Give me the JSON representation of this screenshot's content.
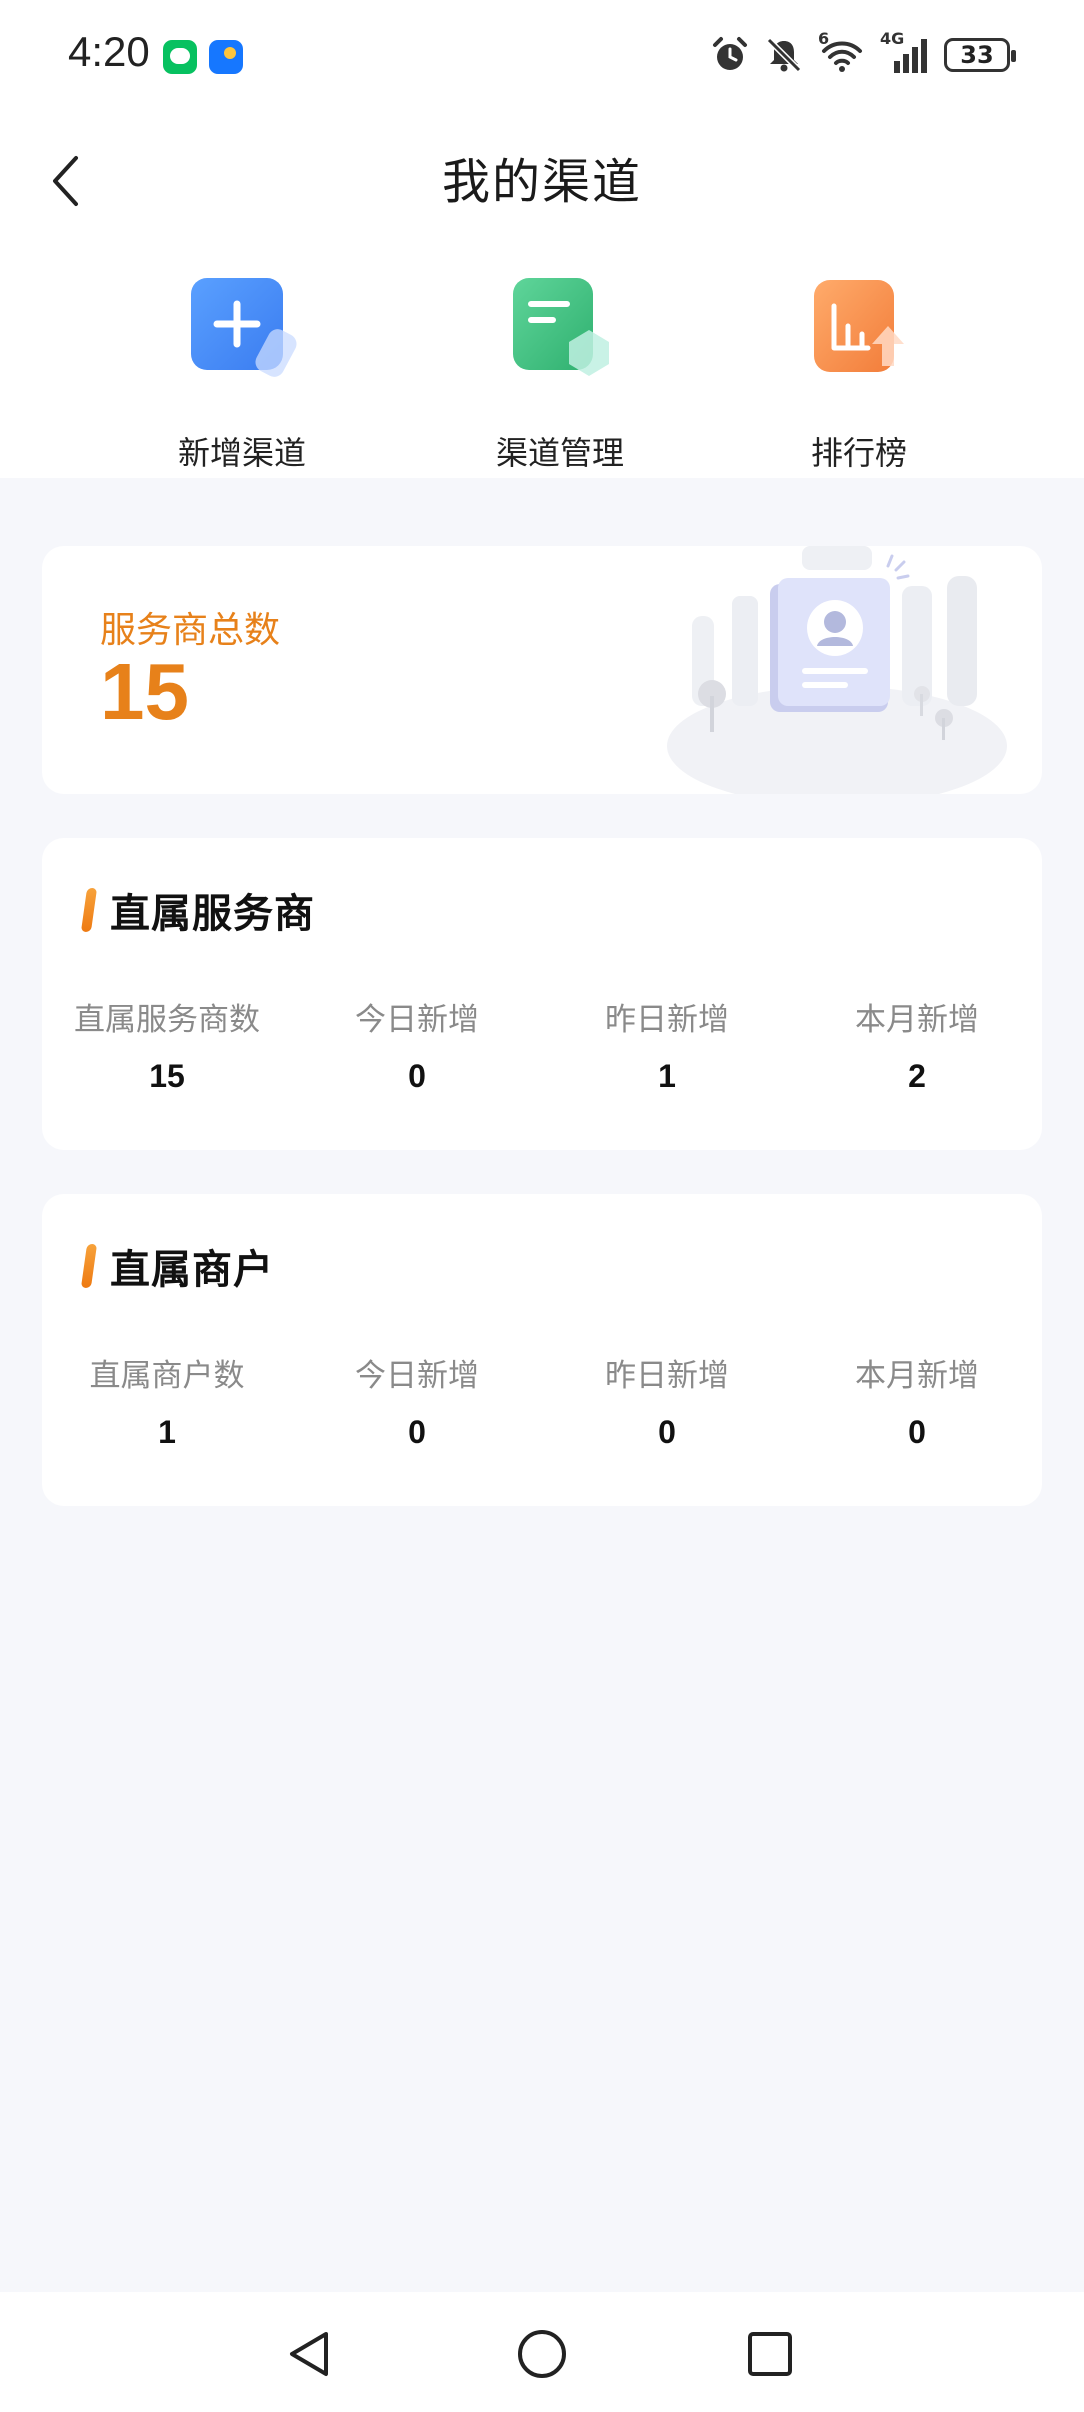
{
  "status_bar": {
    "time": "4:20",
    "battery": "33",
    "network": "4G",
    "wifi_badge": "6",
    "icons": [
      "wechat-icon",
      "weather-icon",
      "alarm-icon",
      "mute-icon",
      "wifi-icon",
      "signal-icon",
      "battery-icon"
    ]
  },
  "header": {
    "title": "我的渠道"
  },
  "quick_actions": [
    {
      "label": "新增渠道",
      "icon": "add-channel-icon",
      "color": "#4d8ff5"
    },
    {
      "label": "渠道管理",
      "icon": "channel-manage-icon",
      "color": "#45c285"
    },
    {
      "label": "排行榜",
      "icon": "ranking-icon",
      "color": "#f58b45"
    }
  ],
  "summary": {
    "label": "服务商总数",
    "value": "15",
    "accent_color": "#e7811a"
  },
  "direct_providers": {
    "title": "直属服务商",
    "stats": [
      {
        "label": "直属服务商数",
        "value": "15"
      },
      {
        "label": "今日新增",
        "value": "0"
      },
      {
        "label": "昨日新增",
        "value": "1"
      },
      {
        "label": "本月新增",
        "value": "2"
      }
    ]
  },
  "direct_merchants": {
    "title": "直属商户",
    "stats": [
      {
        "label": "直属商户数",
        "value": "1"
      },
      {
        "label": "今日新增",
        "value": "0"
      },
      {
        "label": "昨日新增",
        "value": "0"
      },
      {
        "label": "本月新增",
        "value": "0"
      }
    ]
  },
  "system_nav": [
    "back-triangle-icon",
    "home-circle-icon",
    "recents-square-icon"
  ]
}
